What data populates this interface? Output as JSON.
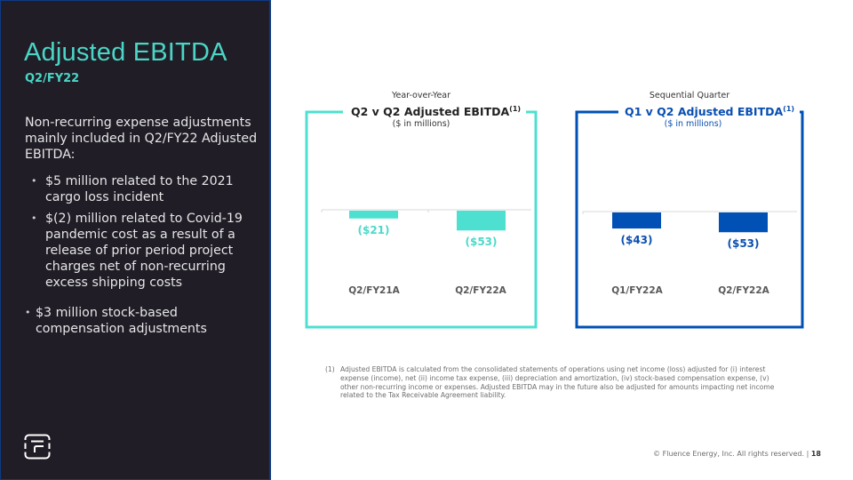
{
  "slide": {
    "title": "Adjusted EBITDA",
    "subtitle": "Q2/FY22",
    "intro": "Non-recurring expense adjustments mainly included in Q2/FY22 Adjusted EBITDA:",
    "sub_bullets": [
      "$5 million related to the 2021 cargo loss incident",
      "$(2) million related to Covid-19 pandemic cost as a result of a release of prior period project charges net of non-recurring excess shipping costs"
    ],
    "outer_bullets": [
      "$3 million stock-based compensation adjustments"
    ],
    "logo": "fluence-logo-icon",
    "footnote_number": "(1)",
    "footnote_text": "Adjusted EBITDA is calculated from the consolidated statements of operations using net income (loss) adjusted for (i) interest expense (income), net (ii) income tax expense, (iii) depreciation and amortization, (iv) stock-based compensation expense, (v) other non-recurring income or expenses. Adjusted EBITDA may in the future also be adjusted for amounts impacting net income related to the Tax Receivable Agreement liability.",
    "copyright": "© Fluence Energy, Inc. All rights reserved.",
    "page_separator": "|",
    "page_number": "18"
  },
  "chart_data": [
    {
      "type": "bar",
      "caption": "Year-over-Year",
      "title": "Q2 v Q2  Adjusted EBITDA",
      "title_sup": "(1)",
      "units": "($ in millions)",
      "categories": [
        "Q2/FY21A",
        "Q2/FY22A"
      ],
      "values": [
        -21,
        -53
      ],
      "value_labels": [
        "($21)",
        "($53)"
      ],
      "color": "#4de0d0",
      "label_color": "#4dd9c9",
      "xlabel": "",
      "ylabel": "",
      "ylim": [
        -100,
        0
      ],
      "grid": false,
      "legend": "none"
    },
    {
      "type": "bar",
      "caption": "Sequential Quarter",
      "title": "Q1 v Q2 Adjusted EBITDA",
      "title_sup": "(1)",
      "units": "($ in millions)",
      "categories": [
        "Q1/FY22A",
        "Q2/FY22A"
      ],
      "values": [
        -43,
        -53
      ],
      "value_labels": [
        "($43)",
        "($53)"
      ],
      "color": "#0050b5",
      "label_color": "#0a4fb0",
      "xlabel": "",
      "ylabel": "",
      "ylim": [
        -100,
        0
      ],
      "grid": false,
      "legend": "none"
    }
  ]
}
